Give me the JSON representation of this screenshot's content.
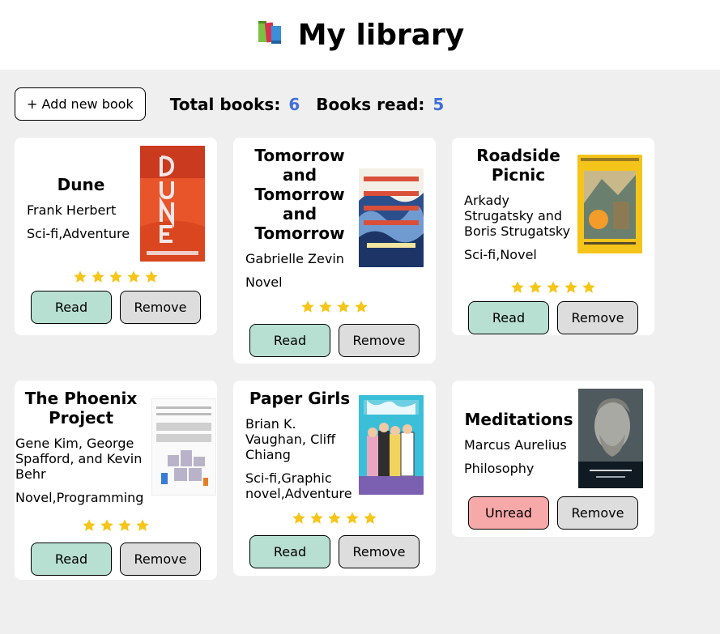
{
  "header": {
    "title": "My library",
    "icon": "books-icon"
  },
  "toolbar": {
    "add_label": "+ Add new book",
    "total_label": "Total books:",
    "total_value": "6",
    "read_label": "Books read:",
    "read_value": "5"
  },
  "colors": {
    "accent_number": "#3f6fd8",
    "read_button": "#b8e0d2",
    "unread_button": "#f7a8a8",
    "remove_button": "#dddddd",
    "star": "#f5c518"
  },
  "books": [
    {
      "title": "Dune",
      "author": "Frank Herbert",
      "genre": "Sci-fi,Adventure",
      "rating": 5,
      "status_label": "Read",
      "remove_label": "Remove"
    },
    {
      "title": "Tomorrow and Tomorrow and Tomorrow",
      "author": "Gabrielle Zevin",
      "genre": "Novel",
      "rating": 4,
      "status_label": "Read",
      "remove_label": "Remove"
    },
    {
      "title": "Roadside Picnic",
      "author": "Arkady Strugatsky and Boris Strugatsky",
      "genre": "Sci-fi,Novel",
      "rating": 5,
      "status_label": "Read",
      "remove_label": "Remove"
    },
    {
      "title": "The Phoenix Project",
      "author": "Gene Kim, George Spafford, and Kevin Behr",
      "genre": "Novel,Programming",
      "rating": 4,
      "status_label": "Read",
      "remove_label": "Remove"
    },
    {
      "title": "Paper Girls",
      "author": "Brian K. Vaughan, Cliff Chiang",
      "genre": "Sci-fi,Graphic novel,Adventure",
      "rating": 5,
      "status_label": "Read",
      "remove_label": "Remove"
    },
    {
      "title": "Meditations",
      "author": "Marcus Aurelius",
      "genre": "Philosophy",
      "rating": 0,
      "status_label": "Unread",
      "remove_label": "Remove"
    }
  ]
}
